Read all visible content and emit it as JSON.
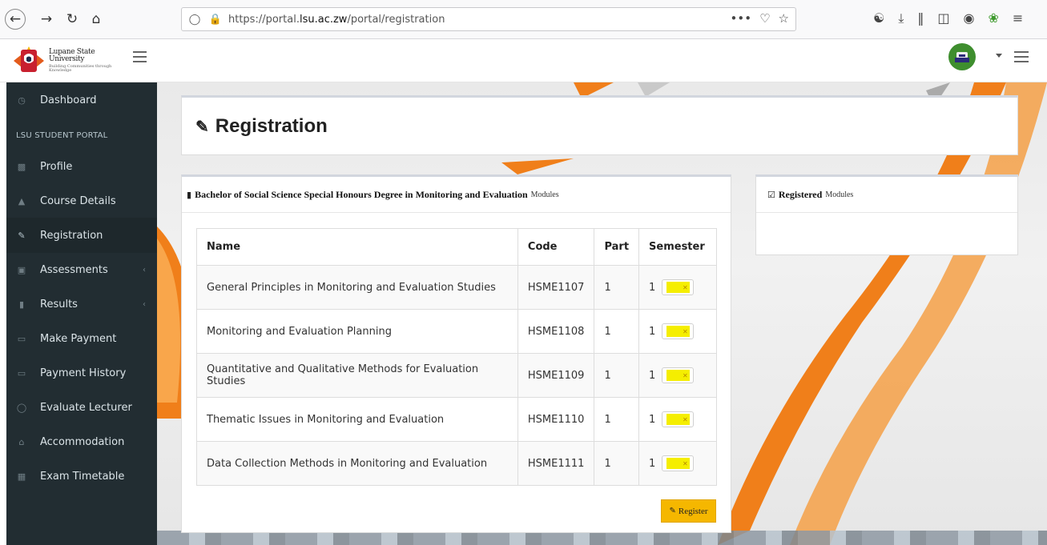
{
  "browser": {
    "url_prefix": "https://portal.",
    "url_domain": "lsu.ac.zw",
    "url_path": "/portal/registration",
    "more_label": "•••"
  },
  "header": {
    "logo_name": "Lupane State University",
    "logo_tagline": "Building Communities through Knowledge"
  },
  "sidebar": {
    "section_header": "LSU STUDENT PORTAL",
    "items": [
      {
        "label": "Dashboard",
        "icon": "dashboard-icon"
      },
      {
        "label": "Profile",
        "icon": "profile-icon"
      },
      {
        "label": "Course Details",
        "icon": "graduation-cap-icon"
      },
      {
        "label": "Registration",
        "icon": "pencil-icon"
      },
      {
        "label": "Assessments",
        "icon": "bank-icon"
      },
      {
        "label": "Results",
        "icon": "book-icon"
      },
      {
        "label": "Make Payment",
        "icon": "credit-card-icon"
      },
      {
        "label": "Payment History",
        "icon": "credit-card-icon"
      },
      {
        "label": "Evaluate Lecturer",
        "icon": "comment-icon"
      },
      {
        "label": "Accommodation",
        "icon": "home-icon"
      },
      {
        "label": "Exam Timetable",
        "icon": "calendar-icon"
      }
    ]
  },
  "page": {
    "title": "Registration"
  },
  "modules_panel": {
    "title": "Bachelor of Social Science Special Honours Degree in Monitoring and Evaluation",
    "subtitle": "Modules",
    "columns": [
      "Name",
      "Code",
      "Part",
      "Semester"
    ],
    "rows": [
      {
        "name": "General Principles in Monitoring and Evaluation Studies",
        "code": "HSME1107",
        "part": "1",
        "semester": "1"
      },
      {
        "name": "Monitoring and Evaluation Planning",
        "code": "HSME1108",
        "part": "1",
        "semester": "1"
      },
      {
        "name": "Quantitative and Qualitative Methods for Evaluation Studies",
        "code": "HSME1109",
        "part": "1",
        "semester": "1"
      },
      {
        "name": "Thematic Issues in Monitoring and Evaluation",
        "code": "HSME1110",
        "part": "1",
        "semester": "1"
      },
      {
        "name": "Data Collection Methods in Monitoring and Evaluation",
        "code": "HSME1111",
        "part": "1",
        "semester": "1"
      }
    ],
    "register_label": "Register"
  },
  "registered_panel": {
    "title": "Registered",
    "subtitle": "Modules"
  },
  "colors": {
    "sidebar_bg": "#222d32",
    "accent_orange": "#f39c12",
    "register_button": "#f5b700",
    "toggle_highlight": "#f5ee00"
  }
}
